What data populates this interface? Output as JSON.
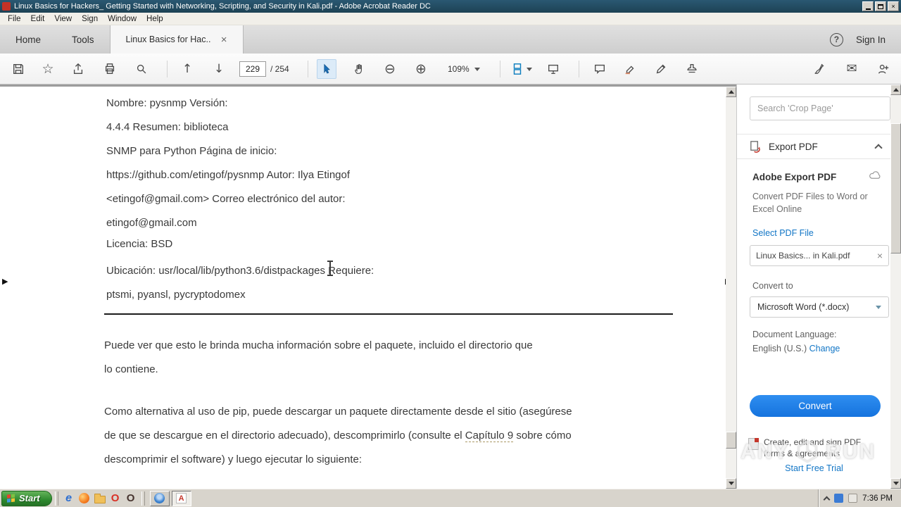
{
  "window": {
    "title": "Linux Basics for Hackers_ Getting Started with Networking, Scripting, and Security in Kali.pdf - Adobe Acrobat Reader DC",
    "menu": [
      "File",
      "Edit",
      "View",
      "Sign",
      "Window",
      "Help"
    ]
  },
  "tabs": {
    "home": "Home",
    "tools": "Tools",
    "doc": "Linux Basics for Hac...",
    "sign_in": "Sign In"
  },
  "toolbar": {
    "page_current": "229",
    "page_total": "/ 254",
    "zoom": "109%"
  },
  "icons": {
    "close": "×",
    "help": "?",
    "star": "☆",
    "page_up": "↑",
    "page_down": "↓",
    "zoom_out": "⊖",
    "zoom_in": "⊕",
    "envelope": "✉",
    "chevron_right": "▶",
    "ie": "e",
    "opera": "O",
    "opera_dark": "O",
    "acrobat": "A"
  },
  "document": {
    "lines": [
      "Nombre: pysnmp Versión:",
      "4.4.4 Resumen: biblioteca",
      "SNMP para Python Página de inicio:",
      "https://github.com/etingof/pysnmp Autor: Ilya Etingof",
      "<etingof@gmail.com> Correo electrónico del autor:",
      "etingof@gmail.com",
      "Licencia: BSD",
      "Ubicación: usr/local/lib/python3.6/distpackages Requiere:",
      "ptsmi, pyansl, pycryptodomex"
    ],
    "para1_l1": "Puede ver que esto le brinda mucha información sobre el paquete, incluido el directorio que",
    "para1_l2": "lo contiene.",
    "para2_l1": "Como alternativa al uso de pip, puede descargar un paquete directamente desde el sitio (asegúrese",
    "para2_l2a": "de que se descargue en el directorio adecuado), descomprimirlo (consulte el ",
    "para2_l2b": "Capítulo 9",
    "para2_l2c": " sobre cómo",
    "para2_l3": "descomprimir el software) y luego ejecutar lo siguiente:"
  },
  "panel": {
    "search_placeholder": "Search 'Crop Page'",
    "export_header": "Export PDF",
    "title": "Adobe Export PDF",
    "description": "Convert PDF Files to Word or Excel Online",
    "select_link": "Select PDF File",
    "file_name": "Linux Basics... in Kali.pdf",
    "convert_to_label": "Convert to",
    "format_value": "Microsoft Word (*.docx)",
    "language_label": "Document Language:",
    "language_value": "English (U.S.) ",
    "change_link": "Change",
    "convert_button": "Convert",
    "promo_text": "Create, edit and sign PDF forms & agreements",
    "trial_link": "Start Free Trial"
  },
  "taskbar": {
    "start": "Start",
    "clock": "7:36 PM"
  },
  "watermark": {
    "left": "ANY",
    "right": "RUN"
  }
}
